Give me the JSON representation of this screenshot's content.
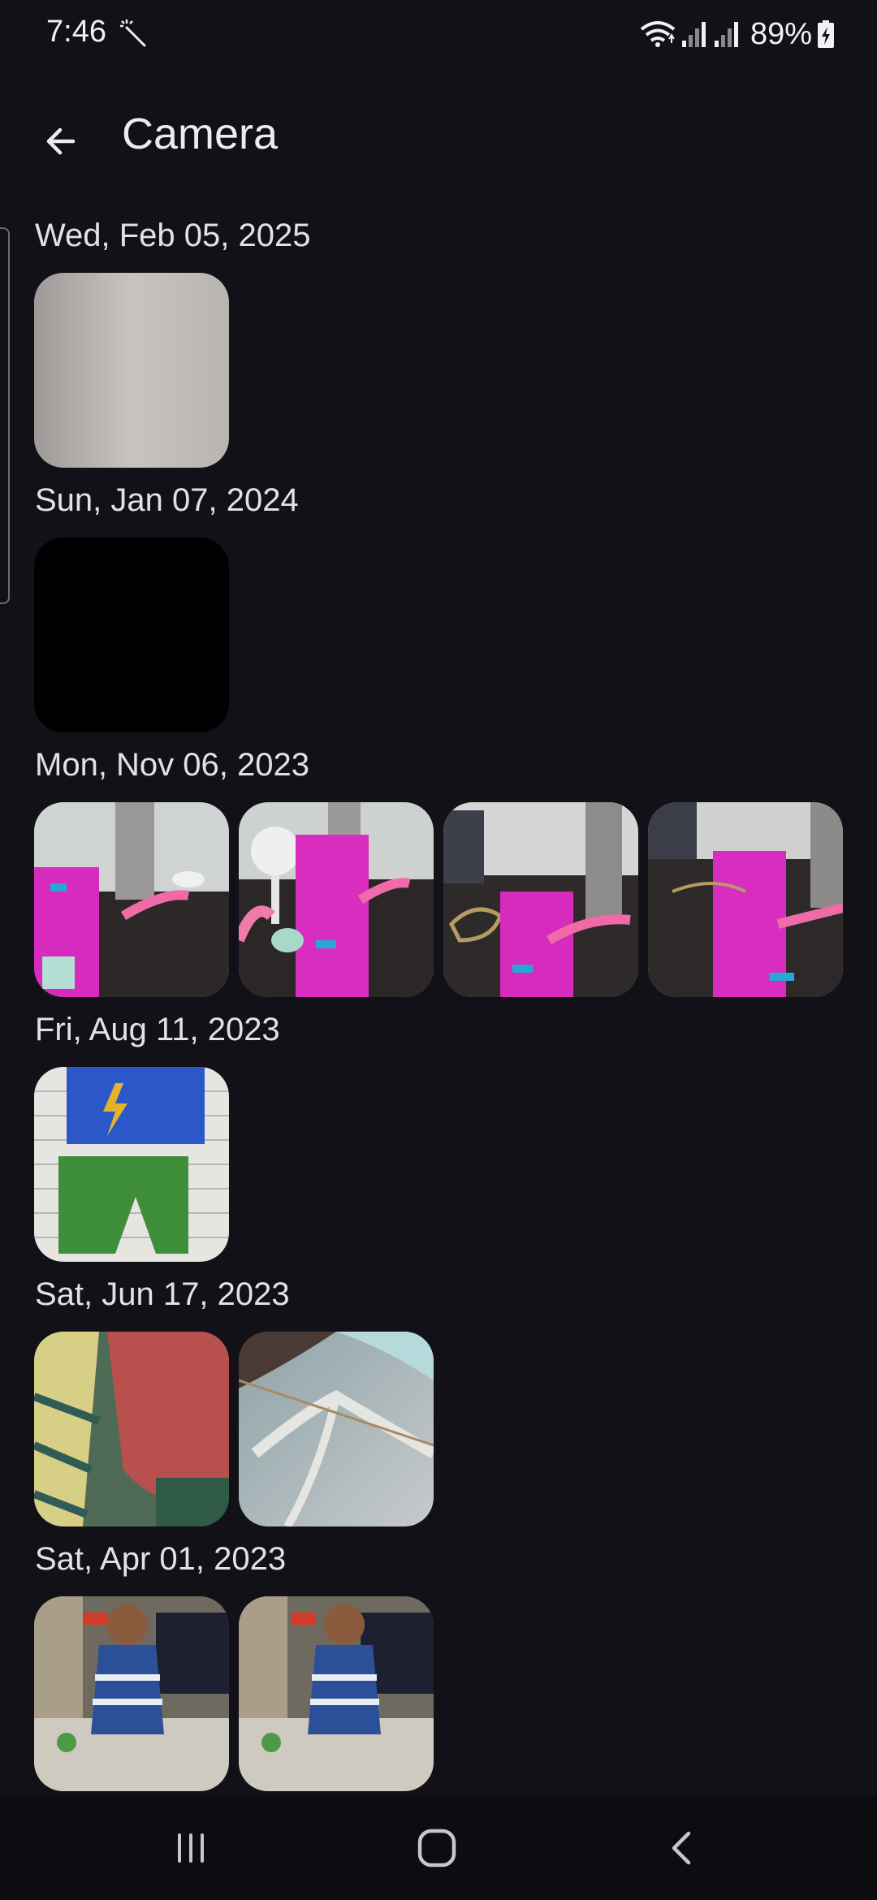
{
  "status_bar": {
    "time": "7:46",
    "battery": "89%"
  },
  "app_bar": {
    "title": "Camera"
  },
  "groups": [
    {
      "date": "Wed, Feb 05, 2025"
    },
    {
      "date": "Sun, Jan 07, 2024"
    },
    {
      "date": "Mon, Nov 06, 2023"
    },
    {
      "date": "Fri, Aug 11, 2023"
    },
    {
      "date": "Sat, Jun 17, 2023"
    },
    {
      "date": "Sat, Apr 01, 2023"
    }
  ],
  "colors": {
    "background": "#131118",
    "nav_background": "#0d0c10",
    "text": "#e8e4ee"
  },
  "icons": {
    "back": "arrow-left-icon",
    "recents": "recents-icon",
    "home": "home-icon",
    "nav_back": "chevron-left-icon"
  }
}
